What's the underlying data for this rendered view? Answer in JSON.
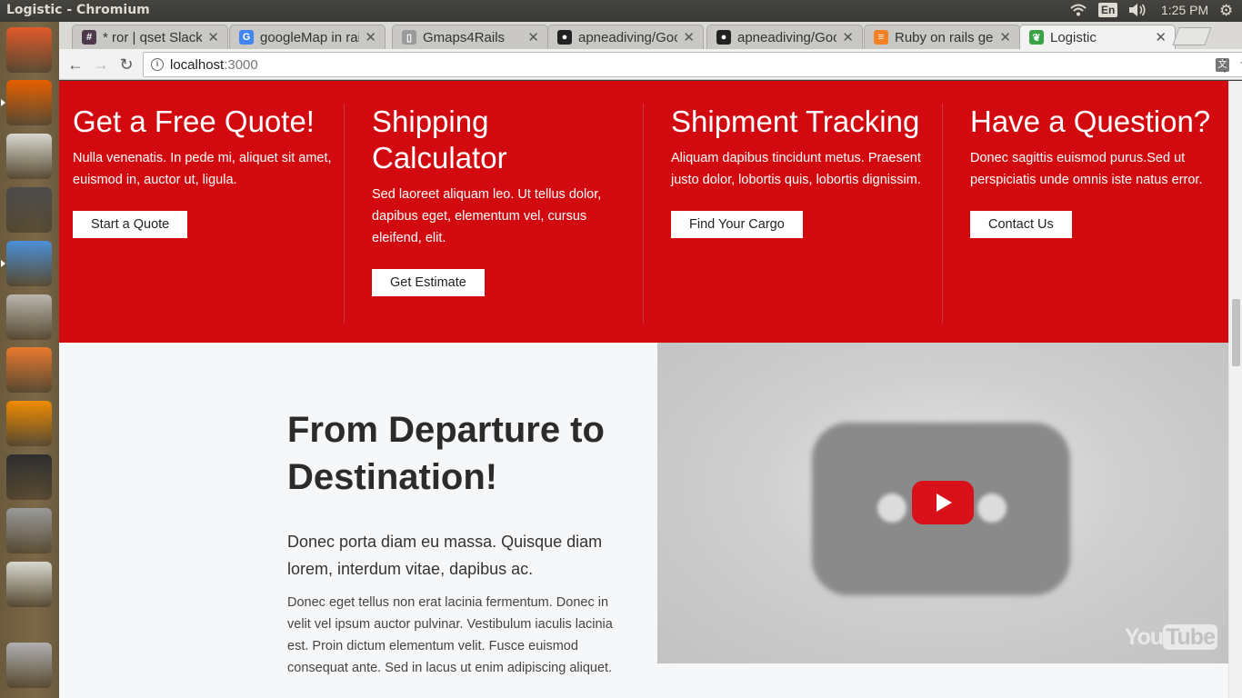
{
  "os": {
    "window_title": "Logistic - Chromium",
    "keyboard_layout": "En",
    "clock": "1:25 PM"
  },
  "launcher": {
    "items": [
      {
        "name": "ubuntu-dash-icon",
        "color": "#e05a2b"
      },
      {
        "name": "firefox-icon",
        "color": "#e66000"
      },
      {
        "name": "text-editor-icon",
        "color": "#d8d8d0"
      },
      {
        "name": "sublime-text-icon",
        "color": "#4b4b4b"
      },
      {
        "name": "chromium-icon",
        "color": "#4a90d9"
      },
      {
        "name": "files-icon",
        "color": "#b9b6ae"
      },
      {
        "name": "software-center-icon",
        "color": "#e8792d"
      },
      {
        "name": "vlc-icon",
        "color": "#f08c00"
      },
      {
        "name": "terminal-icon",
        "color": "#2e2e2e"
      },
      {
        "name": "system-settings-icon",
        "color": "#9a9a9a"
      },
      {
        "name": "notes-icon",
        "color": "#d8d8d0"
      },
      {
        "name": "trash-icon",
        "color": "#b0b0b0"
      }
    ]
  },
  "browser": {
    "tabs": [
      {
        "label": "* ror | qset Slack",
        "favicon": "slack-icon",
        "favicon_char": "#",
        "favicon_color": "#4d394b"
      },
      {
        "label": "googleMap in rails",
        "favicon": "google-icon",
        "favicon_char": "G",
        "favicon_color": "#4285f4"
      },
      {
        "label": "Gmaps4Rails",
        "favicon": "document-icon",
        "favicon_char": "▯",
        "favicon_color": "#9a9a9a"
      },
      {
        "label": "apneadiving/Google",
        "favicon": "github-icon",
        "favicon_char": "●",
        "favicon_color": "#222222"
      },
      {
        "label": "apneadiving/Google",
        "favicon": "github-icon",
        "favicon_char": "●",
        "favicon_color": "#222222"
      },
      {
        "label": "Ruby on rails gem",
        "favicon": "stackoverflow-icon",
        "favicon_char": "≡",
        "favicon_color": "#f48024"
      },
      {
        "label": "Logistic",
        "favicon": "leaf-icon",
        "favicon_char": "❦",
        "favicon_color": "#3aa346",
        "active": true
      }
    ],
    "url_host": "localhost",
    "url_port": ":3000"
  },
  "page": {
    "accent_color": "#d20a10",
    "features": [
      {
        "title": "Get a Free Quote!",
        "text": "Nulla venenatis. In pede mi, aliquet sit amet, euismod in, auctor ut, ligula.",
        "button": "Start a Quote"
      },
      {
        "title": "Shipping Calculator",
        "text": "Sed laoreet aliquam leo. Ut tellus dolor, dapibus eget, elementum vel, cursus eleifend, elit.",
        "button": "Get Estimate"
      },
      {
        "title": "Shipment Tracking",
        "text": "Aliquam dapibus tincidunt metus. Praesent justo dolor, lobortis quis, lobortis dignissim.",
        "button": "Find Your Cargo"
      },
      {
        "title": "Have a Question?",
        "text": "Donec sagittis euismod purus.Sed ut perspiciatis unde omnis iste natus error.",
        "button": "Contact Us"
      }
    ],
    "about": {
      "heading": "From Departure to Destination!",
      "lead": "Donec porta diam eu massa. Quisque diam lorem, interdum vitae, dapibus ac.",
      "body": "Donec eget tellus non erat lacinia fermentum. Donec in velit vel ipsum auctor pulvinar. Vestibulum iaculis lacinia est. Proin dictum elementum velit. Fusce euismod consequat ante. Sed in lacus ut enim adipiscing aliquet."
    },
    "video": {
      "logo_you": "You",
      "logo_tube": "Tube"
    }
  }
}
